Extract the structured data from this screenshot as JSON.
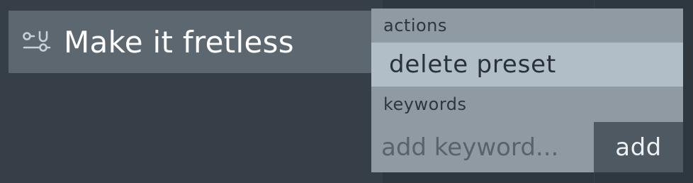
{
  "preset": {
    "name": "Make it fretless",
    "icon": "sliders-icon"
  },
  "menu": {
    "actions_label": "actions",
    "delete_label": "delete preset",
    "keywords_label": "keywords",
    "keyword_placeholder": "add keyword...",
    "add_label": "add"
  },
  "colors": {
    "background": "#363f48",
    "row": "#5d6770",
    "menu": "#8f9aa3",
    "menu_item_highlight": "#b1bec7",
    "button": "#4e5962"
  }
}
